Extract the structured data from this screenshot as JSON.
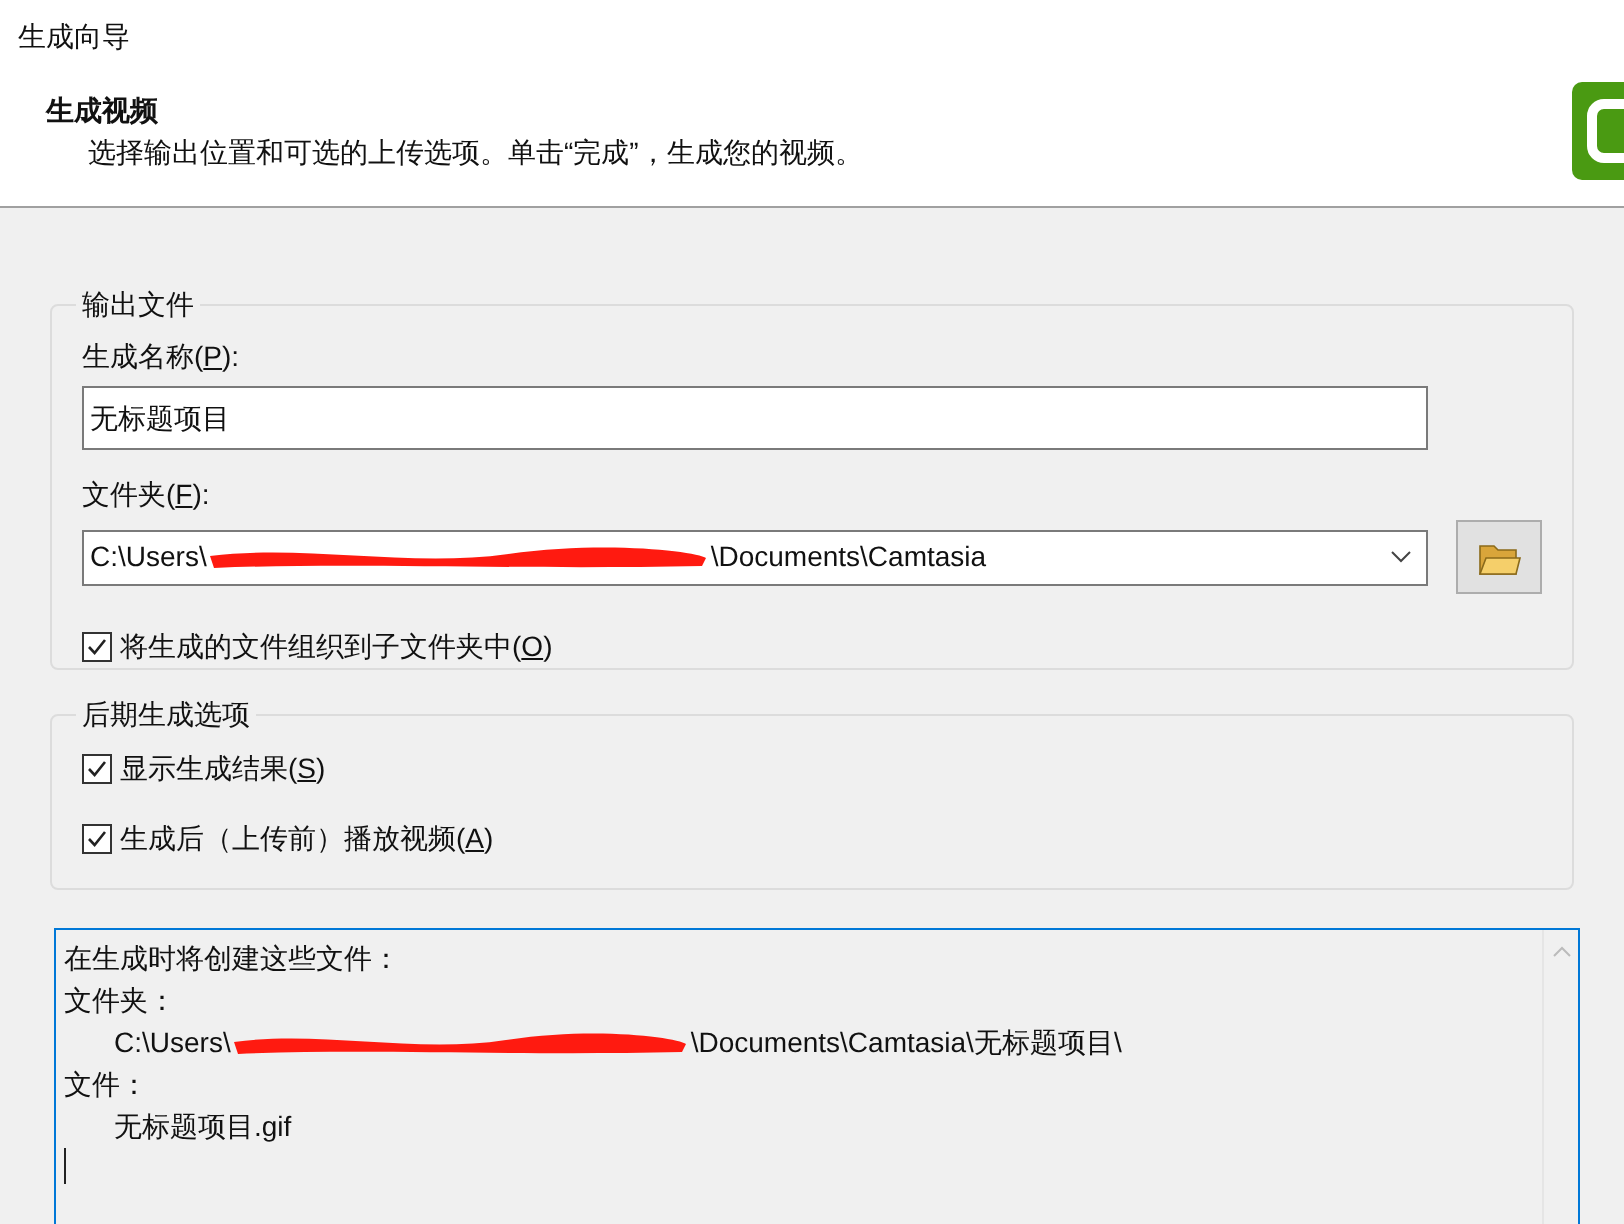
{
  "window": {
    "title": "生成向导"
  },
  "header": {
    "title": "生成视频",
    "subtitle": "选择输出位置和可选的上传选项。单击“完成”，生成您的视频。"
  },
  "output_group": {
    "title": "输出文件",
    "name_field": {
      "label": {
        "before": "生成名称(",
        "mnemonic": "P",
        "after": "):"
      },
      "value": "无标题项目"
    },
    "folder_field": {
      "label": {
        "before": "文件夹(",
        "mnemonic": "F",
        "after": "):"
      },
      "value_start": "C:\\Users\\",
      "value_end": "\\Documents\\Camtasia",
      "redacted": true
    },
    "checkboxes": [
      {
        "label": {
          "before": "将生成的文件组织到子文件夹中(",
          "mnemonic": "O",
          "after": ")"
        },
        "checked": true
      }
    ]
  },
  "post_group": {
    "title": "后期生成选项",
    "checkboxes": [
      {
        "label": {
          "before": "显示生成结果(",
          "mnemonic": "S",
          "after": ")"
        },
        "checked": true
      },
      {
        "label": {
          "before": "生成后（上传前）播放视频(",
          "mnemonic": "A",
          "after": ")"
        },
        "checked": true
      }
    ]
  },
  "summary": {
    "lines": [
      {
        "text": "在生成时将创建这些文件：",
        "indent": false
      },
      {
        "text": "文件夹：",
        "indent": false
      },
      {
        "text": "C:\\Users\\",
        "text_end": "\\Documents\\Camtasia\\无标题项目\\",
        "indent": true,
        "redacted": true
      },
      {
        "text": "文件：",
        "indent": false
      },
      {
        "text": "无标题项目.gif",
        "indent": true
      }
    ]
  }
}
